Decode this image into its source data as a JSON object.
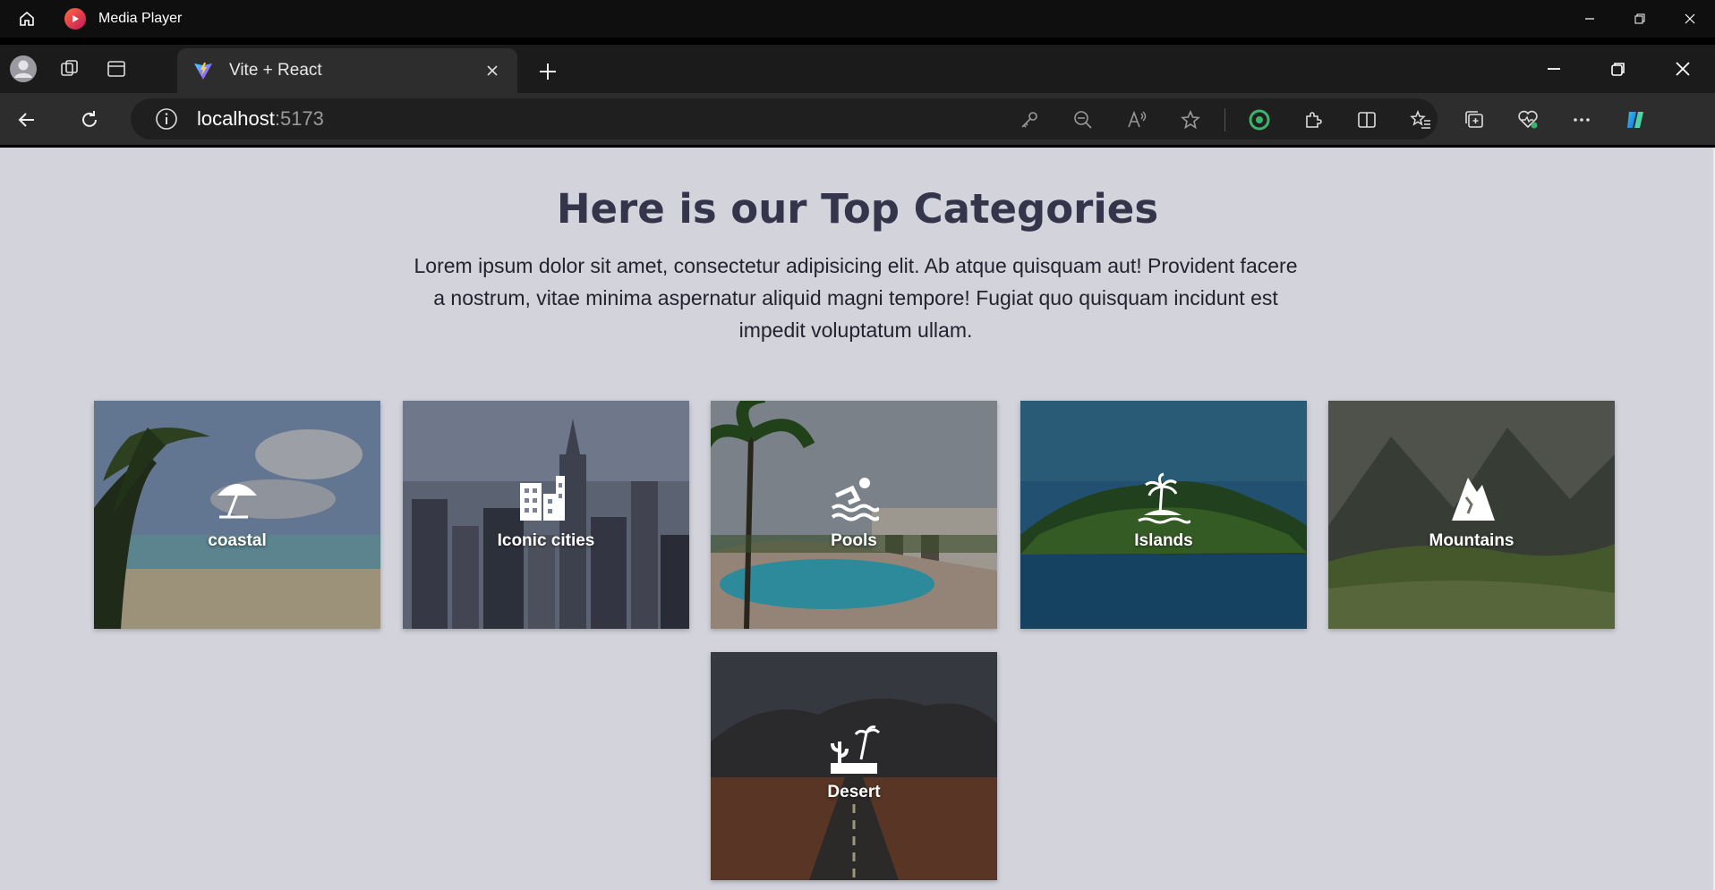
{
  "media_player": {
    "title": "Media Player"
  },
  "browser": {
    "tab": {
      "title": "Vite + React"
    },
    "address": {
      "host": "localhost",
      "port": ":5173"
    }
  },
  "page": {
    "heading": "Here is our Top Categories",
    "description": "Lorem ipsum dolor sit amet, consectetur adipisicing elit. Ab atque quisquam aut! Provident facere a nostrum, vitae minima aspernatur aliquid magni tempore! Fugiat quo quisquam incidunt est impedit voluptatum ullam.",
    "categories": [
      {
        "label": "coastal",
        "icon": "beach-umbrella-icon"
      },
      {
        "label": "Iconic cities",
        "icon": "city-icon"
      },
      {
        "label": "Pools",
        "icon": "swimmer-icon"
      },
      {
        "label": "Islands",
        "icon": "island-icon"
      },
      {
        "label": "Mountains",
        "icon": "mountain-icon"
      },
      {
        "label": "Desert",
        "icon": "desert-icon"
      }
    ]
  },
  "colors": {
    "page_bg": "#d3d3dc",
    "heading": "#34344a",
    "chrome_dark": "#1b1b1b",
    "chrome_mid": "#2d2d2d"
  }
}
